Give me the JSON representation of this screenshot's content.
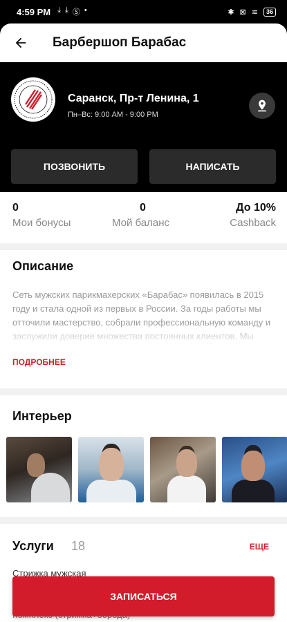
{
  "status_bar": {
    "time": "4:59 PM",
    "battery": "36"
  },
  "header": {
    "title": "Барбершоп Барабас"
  },
  "shop": {
    "address": "Саранск, Пр-т Ленина, 1",
    "hours": "Пн–Вс: 9:00 AM - 9:00 PM",
    "call_label": "ПОЗВОНИТЬ",
    "message_label": "НАПИСАТЬ"
  },
  "stats": [
    {
      "value": "0",
      "label": "Мои бонусы"
    },
    {
      "value": "0",
      "label": "Мой баланс"
    },
    {
      "value": "До 10%",
      "label": "Cashback"
    }
  ],
  "description": {
    "title": "Описание",
    "text": "Сеть мужских парикмахерских «Барабас» появилась в 2015 году и стала одной из первых в России. За годы работы мы отточили мастерство, собрали профессиональную команду и заслужили доверие множества постоянных клиентов. Мы следуем совр...",
    "more_label": "ПОДРОБНЕЕ"
  },
  "interior": {
    "title": "Интерьер"
  },
  "services": {
    "title": "Услуги",
    "count": "18",
    "more_label": "ЕЩЕ",
    "items": [
      "Стрижка мужская",
      "Комплекс (стрижка+борода)"
    ]
  },
  "cta": {
    "label": "ЗАПИСАТЬСЯ"
  },
  "colors": {
    "accent": "#d21c2b",
    "hero_bg": "#000000",
    "button_dark": "#2b2b2b"
  }
}
